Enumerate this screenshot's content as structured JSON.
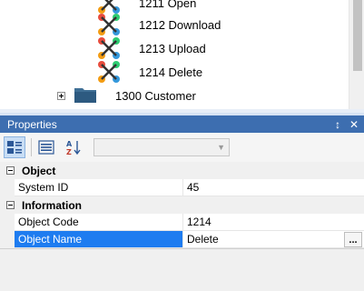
{
  "tree": {
    "items": [
      {
        "label": "1211 Open",
        "icon": "workflow-icon"
      },
      {
        "label": "1212 Download",
        "icon": "workflow-icon"
      },
      {
        "label": "1213 Upload",
        "icon": "workflow-icon"
      },
      {
        "label": "1214 Delete",
        "icon": "workflow-icon"
      }
    ],
    "folder": {
      "label": "1300 Customer",
      "icon": "folder-icon"
    }
  },
  "properties": {
    "title": "Properties",
    "pin_glyph": "↕",
    "close_glyph": "✕",
    "toolbar": {
      "buttons": [
        "categorized-view-icon",
        "alphabetical-list-icon",
        "sort-az-icon"
      ],
      "combo_value": ""
    },
    "categories": [
      {
        "name": "Object",
        "rows": [
          {
            "name": "System ID",
            "value": "45"
          }
        ]
      },
      {
        "name": "Information",
        "rows": [
          {
            "name": "Object Code",
            "value": "1214"
          },
          {
            "name": "Object Name",
            "value": "Delete",
            "ellipsis": "..."
          }
        ]
      }
    ]
  },
  "colors": {
    "title_bar": "#3d6eb0",
    "selected": "#1e7cf0"
  }
}
